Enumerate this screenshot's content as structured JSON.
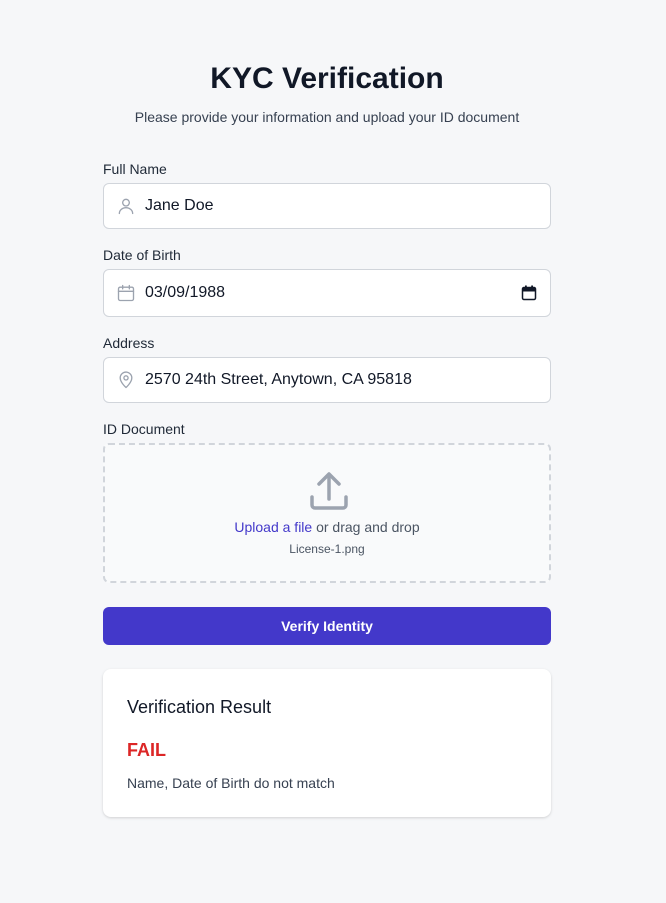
{
  "header": {
    "title": "KYC Verification",
    "subtitle": "Please provide your information and upload your ID document"
  },
  "form": {
    "full_name": {
      "label": "Full Name",
      "value": "Jane Doe",
      "icon": "user-icon"
    },
    "dob": {
      "label": "Date of Birth",
      "value": "03/09/1988",
      "icon": "calendar-icon"
    },
    "address": {
      "label": "Address",
      "value": "2570 24th Street, Anytown, CA 95818",
      "icon": "map-pin-icon"
    },
    "id_document": {
      "label": "ID Document",
      "upload_link": "Upload a file",
      "upload_suffix": " or drag and drop",
      "filename": "License-1.png",
      "icon": "upload-icon"
    },
    "submit_label": "Verify Identity"
  },
  "result": {
    "title": "Verification Result",
    "status": "FAIL",
    "message": "Name, Date of Birth do not match"
  },
  "colors": {
    "accent": "#4338ca",
    "fail": "#dc2626",
    "background": "#f6f7f9"
  }
}
